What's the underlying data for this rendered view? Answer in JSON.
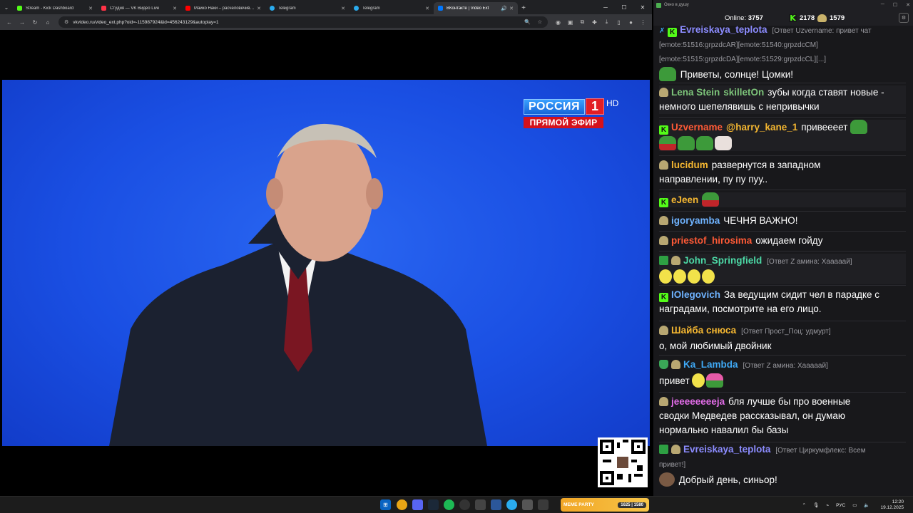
{
  "browser": {
    "tabs": [
      {
        "label": "Stream - Kick Dashboard",
        "color": "#53fc18"
      },
      {
        "label": "Студия — VK Видео Live",
        "color": "#ff3347"
      },
      {
        "label": "Майко Наки – расчеловечивание",
        "color": "#ff0000"
      },
      {
        "label": "Telegram",
        "color": "#2aabee"
      },
      {
        "label": "Telegram",
        "color": "#2aabee"
      },
      {
        "label": "ВКонтакте | Video Ext",
        "color": "#0077ff"
      }
    ],
    "url": "vkvideo.ru/video_ext.php?oid=-115987924&id=456243129&autoplay=1"
  },
  "video": {
    "channel_name": "РОССИЯ",
    "channel_number": "1",
    "channel_hd": "HD",
    "live_label": "ПРЯМОЙ ЭФИР"
  },
  "chat": {
    "window_title": "Окно в душу",
    "online_label": "Online:",
    "online_count": "3757",
    "kick_count": "2178",
    "other_count": "1579",
    "messages": [
      {
        "user": "Evreiskaya_teplota",
        "color": "#8c8cff",
        "reply": "[Ответ Uzvername: привет чат",
        "line2": "[emote:51516:grpzdcAR][emote:51540:grpzdcCM]",
        "line3": "[emote:51515:grpzdcDA][emote:51529:grpzdcCL][...]",
        "text": "Приветы, солнце! Цомки!"
      },
      {
        "user": "Lena Stein",
        "user2": "skilletOn",
        "color": "#7dc47a",
        "text": "зубы когда ставят новые -",
        "text2": "немного шепелявишь с непривычки"
      },
      {
        "user": "Uzvername",
        "mention": "@harry_kane_1",
        "color": "#ff5a36",
        "text": "привеееет"
      },
      {
        "user": "lucidum",
        "color": "#f5b731",
        "text": "развернутся в западном",
        "text2": "направлении, пу пу пуу.."
      },
      {
        "user": "eJeen",
        "color": "#f5b731",
        "text": ""
      },
      {
        "user": "igoryamba",
        "color": "#6fb3ff",
        "text": "ЧЕЧНЯ ВАЖНО!"
      },
      {
        "user": "priestof_hirosima",
        "color": "#ff5a36",
        "text": "ожидаем гойду"
      },
      {
        "user": "John_Springfield",
        "color": "#4cd9a6",
        "reply": "[Ответ Z амина: Хааааай]",
        "text": ""
      },
      {
        "user": "IOlegovich",
        "color": "#6fb3ff",
        "text": "За ведущим сидит чел в парадке с",
        "text2": "наградами, посмотрите на его лицо."
      },
      {
        "user": "Шайба снюса",
        "color": "#f5b731",
        "reply": "[Ответ Прост_Поц: удмурт]",
        "text": "о, мой любимый двойник"
      },
      {
        "user": "Ka_Lambda",
        "color": "#3fa9f5",
        "reply": "[Ответ Z амина: Хааааай]",
        "text": "привет"
      },
      {
        "user": "jeeeeeeeeja",
        "color": "#e06ce6",
        "text": "бля лучше бы про военные",
        "text2": "сводки Медведев рассказывал, он думаю",
        "text3": "нормально навалил бы базы"
      },
      {
        "user": "Evreiskaya_teplota",
        "color": "#8c8cff",
        "reply": "[Ответ Циркумфлекс: Всем",
        "reply2": "привет!]",
        "text": "Добрый день, синьор!"
      }
    ]
  },
  "taskbar": {
    "meme_label": "MEME PARTY",
    "meme_stats": "1625 | 1580",
    "lang": "РУС",
    "time": "12:20",
    "date": "19.12.2025"
  }
}
